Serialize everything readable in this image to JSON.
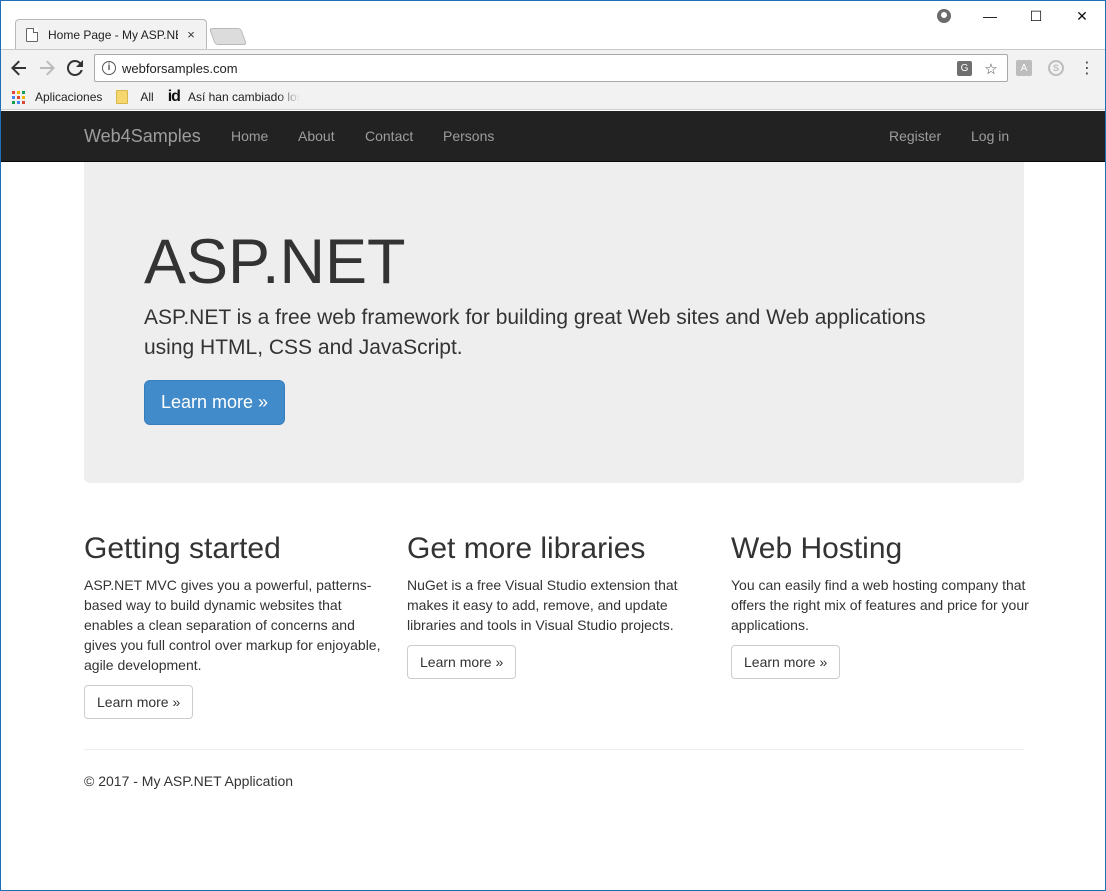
{
  "browser": {
    "tab_title": "Home Page - My ASP.NE",
    "tab_close": "×",
    "url": "webforsamples.com",
    "window_controls": {
      "minimize": "—",
      "maximize": "☐",
      "close": "✕"
    },
    "bookmarks": {
      "apps": "Aplicaciones",
      "all": "All",
      "id_logo": "id",
      "article": "Así han cambiado los"
    }
  },
  "site": {
    "brand": "Web4Samples",
    "nav": [
      "Home",
      "About",
      "Contact",
      "Persons"
    ],
    "nav_right": [
      "Register",
      "Log in"
    ],
    "jumbotron": {
      "title": "ASP.NET",
      "lead": "ASP.NET is a free web framework for building great Web sites and Web applications using HTML, CSS and JavaScript.",
      "button": "Learn more »"
    },
    "columns": [
      {
        "title": "Getting started",
        "text": "ASP.NET MVC gives you a powerful, patterns-based way to build dynamic websites that enables a clean separation of concerns and gives you full control over markup for enjoyable, agile development.",
        "button": "Learn more »"
      },
      {
        "title": "Get more libraries",
        "text": "NuGet is a free Visual Studio extension that makes it easy to add, remove, and update libraries and tools in Visual Studio projects.",
        "button": "Learn more »"
      },
      {
        "title": "Web Hosting",
        "text": "You can easily find a web hosting company that offers the right mix of features and price for your applications.",
        "button": "Learn more »"
      }
    ],
    "footer": "© 2017 - My ASP.NET Application"
  },
  "colors": {
    "navbar_bg": "#222222",
    "nav_text": "#9d9d9d",
    "jumbotron_bg": "#eeeeee",
    "primary": "#428bca"
  }
}
